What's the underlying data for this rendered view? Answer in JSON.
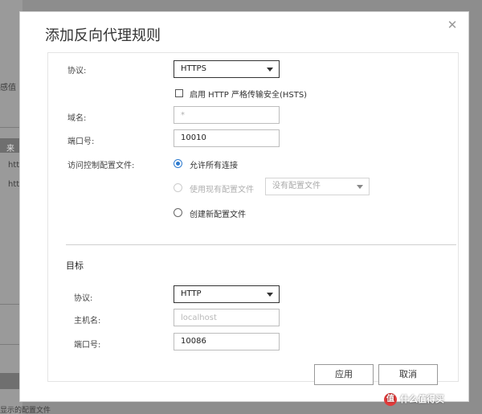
{
  "background": {
    "fragment_1": "感值",
    "fragment_2": "来",
    "fragment_3": "htt",
    "fragment_4": "htt",
    "fragment_5": "显示的配置文件"
  },
  "dialog": {
    "title": "添加反向代理规则",
    "close_glyph": "✕",
    "source": {
      "protocol_label": "协议:",
      "protocol_value": "HTTPS",
      "hsts_label": "启用 HTTP 严格传输安全(HSTS)",
      "hsts_checked": false,
      "domain_label": "域名:",
      "domain_placeholder": "*",
      "port_label": "端口号:",
      "port_value": "10010",
      "access_label": "访问控制配置文件:",
      "access_options": {
        "allow_all": "允许所有连接",
        "use_existing": "使用现有配置文件",
        "create_new": "创建新配置文件"
      },
      "access_selected": "allow_all",
      "existing_profile_value": "没有配置文件"
    },
    "target": {
      "section_title": "目标",
      "protocol_label": "协议:",
      "protocol_value": "HTTP",
      "host_label": "主机名:",
      "host_placeholder": "localhost",
      "port_label": "端口号:",
      "port_value": "10086"
    },
    "buttons": {
      "apply": "应用",
      "cancel": "取消"
    }
  },
  "watermark": {
    "badge": "值",
    "text": "什么值得买"
  },
  "colors": {
    "accent_radio": "#2e7bcf",
    "overlay": "#8d8d8d"
  }
}
